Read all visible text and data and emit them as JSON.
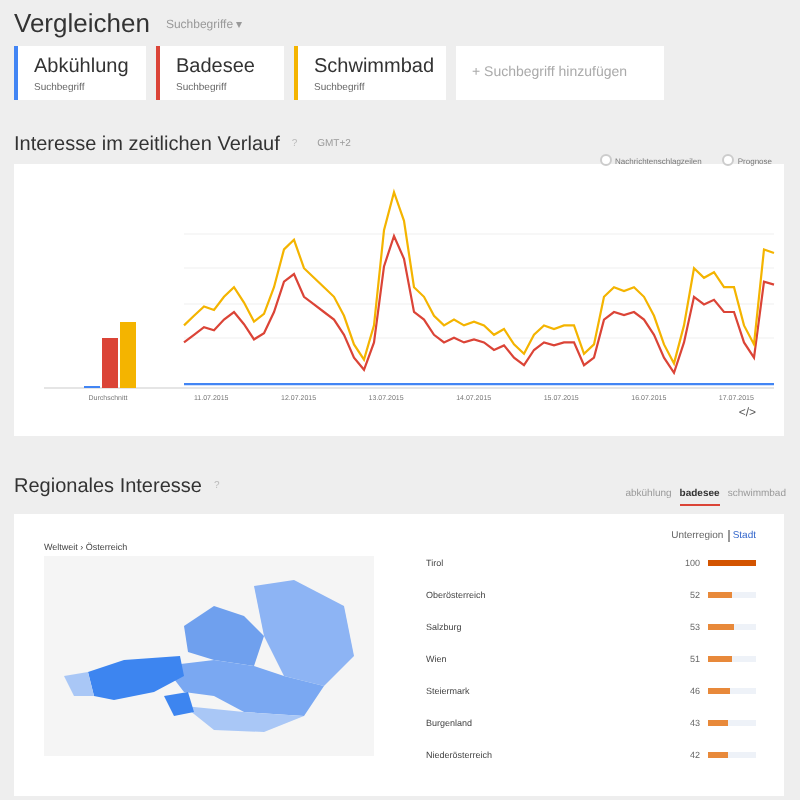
{
  "header": {
    "title": "Vergleichen",
    "dropdown": "Suchbegriffe ▾"
  },
  "terms": [
    {
      "name": "Abkühlung",
      "subtitle": "Suchbegriff",
      "color": "#4285f4"
    },
    {
      "name": "Badesee",
      "subtitle": "Suchbegriff",
      "color": "#db4437"
    },
    {
      "name": "Schwimmbad",
      "subtitle": "Suchbegriff",
      "color": "#f4b400"
    }
  ],
  "add_term": "+ Suchbegriff hinzufügen",
  "timeline": {
    "title": "Interesse im zeitlichen Verlauf",
    "info": "?",
    "timezone": "GMT+2",
    "options": [
      {
        "label": "Nachrichtenschlagzeilen",
        "checked": false
      },
      {
        "label": "Prognose",
        "checked": false
      }
    ],
    "average_label": "Durchschnitt",
    "dates": [
      "11.07.2015",
      "12.07.2015",
      "13.07.2015",
      "14.07.2015",
      "15.07.2015",
      "16.07.2015",
      "17.07.2015"
    ],
    "embed": "</>"
  },
  "regional": {
    "title": "Regionales Interesse",
    "info": "?",
    "tabs": [
      {
        "label": "abkühlung",
        "selected": false
      },
      {
        "label": "badesee",
        "selected": true
      },
      {
        "label": "schwimmbad",
        "selected": false
      }
    ],
    "breadcrumb": "Weltweit › Österreich",
    "levels": [
      {
        "label": "Unterregion",
        "selected": true
      },
      {
        "label": "Stadt",
        "selected": false
      }
    ],
    "regions": [
      {
        "name": "Tirol",
        "value": "100",
        "level": 1.0
      },
      {
        "name": "Oberösterreich",
        "value": "52",
        "level": 0.52
      },
      {
        "name": "Salzburg",
        "value": "53",
        "level": 0.53
      },
      {
        "name": "Wien",
        "value": "51",
        "level": 0.51
      },
      {
        "name": "Steiermark",
        "value": "46",
        "level": 0.46
      },
      {
        "name": "Burgenland",
        "value": "43",
        "level": 0.43
      },
      {
        "name": "Niederösterreich",
        "value": "42",
        "level": 0.42
      }
    ]
  }
}
